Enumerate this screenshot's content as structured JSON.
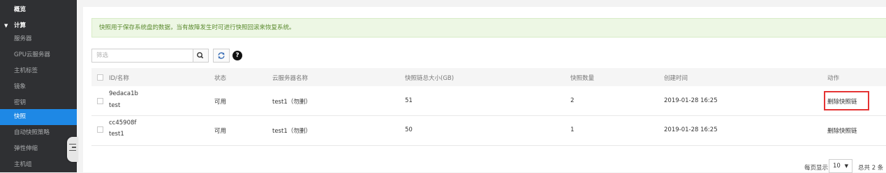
{
  "sidebar": {
    "items": [
      {
        "label": "概览",
        "kind": "head"
      },
      {
        "label": "计算",
        "kind": "head"
      },
      {
        "label": "服务器",
        "kind": "item"
      },
      {
        "label": "GPU云服务器",
        "kind": "item"
      },
      {
        "label": "主机标签",
        "kind": "item"
      },
      {
        "label": "镜象",
        "kind": "item"
      },
      {
        "label": "密钥",
        "kind": "item"
      },
      {
        "label": "快照",
        "kind": "active"
      },
      {
        "label": "自动快照策略",
        "kind": "item"
      },
      {
        "label": "弹性伸缩",
        "kind": "item"
      },
      {
        "label": "主机组",
        "kind": "item"
      }
    ]
  },
  "notice": "快照用于保存系统盘的数据，当有故障发生时可进行快照回滚来恢复系统。",
  "toolbar": {
    "filter_placeholder": "筛选",
    "help_glyph": "?"
  },
  "table": {
    "headers": {
      "id_name": "ID/名称",
      "status": "状态",
      "server_name": "云服务器名称",
      "chain_size": "快照链总大小(GB)",
      "snapshot_count": "快照数量",
      "created": "创建时间",
      "action": "动作"
    },
    "rows": [
      {
        "id": "9edaca1b",
        "name": "test",
        "status": "可用",
        "server": "test1（勿删）",
        "size": "51",
        "count": "2",
        "created": "2019-01-28 16:25",
        "action": "删除快照链"
      },
      {
        "id": "cc45908f",
        "name": "test1",
        "status": "可用",
        "server": "test1（勿删）",
        "size": "50",
        "count": "1",
        "created": "2019-01-28 16:25",
        "action": "删除快照链"
      }
    ]
  },
  "pagination": {
    "per_page_label": "每页显示",
    "per_page_value": "10",
    "total_label": "总共 2 条"
  },
  "colors": {
    "sidebar_bg": "#2f3033",
    "active_item": "#1e88e5",
    "link": "#2a8ae6",
    "highlight_border": "#e53333",
    "notice_bg": "#edf7e4"
  }
}
